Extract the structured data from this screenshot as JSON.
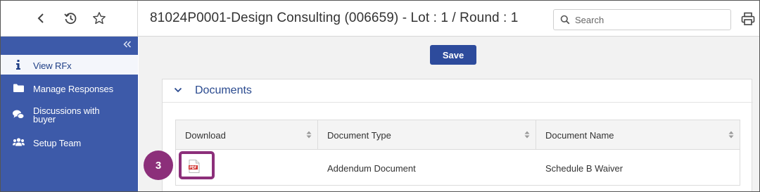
{
  "header": {
    "title": "81024P0001-Design Consulting (006659) - Lot : 1 / Round : 1",
    "search_placeholder": "Search",
    "back_icon": "chevron-left-icon",
    "history_icon": "history-icon",
    "favorite_icon": "star-icon",
    "print_icon": "printer-icon"
  },
  "sidebar": {
    "collapse_icon": "double-chevron-left-icon",
    "items": [
      {
        "label": "View RFx",
        "icon": "info-icon",
        "active": true
      },
      {
        "label": "Manage Responses",
        "icon": "folder-icon",
        "active": false
      },
      {
        "label_line1": "Discussions with",
        "label_line2": "buyer",
        "icon": "chat-icon",
        "active": false
      },
      {
        "label": "Setup Team",
        "icon": "users-icon",
        "active": false
      }
    ]
  },
  "toolbar": {
    "save_label": "Save"
  },
  "documents": {
    "section_title": "Documents",
    "columns": [
      "Download",
      "Document Type",
      "Document Name"
    ],
    "rows": [
      {
        "download_icon": "pdf-icon",
        "type": "Addendum Document",
        "name": "Schedule B Waiver"
      }
    ]
  },
  "callout": {
    "step_number": "3"
  },
  "colors": {
    "sidebar_bg": "#3d5aa9",
    "accent": "#2d4b9c",
    "callout": "#8c2f7a",
    "section_title": "#2a4a8f"
  }
}
